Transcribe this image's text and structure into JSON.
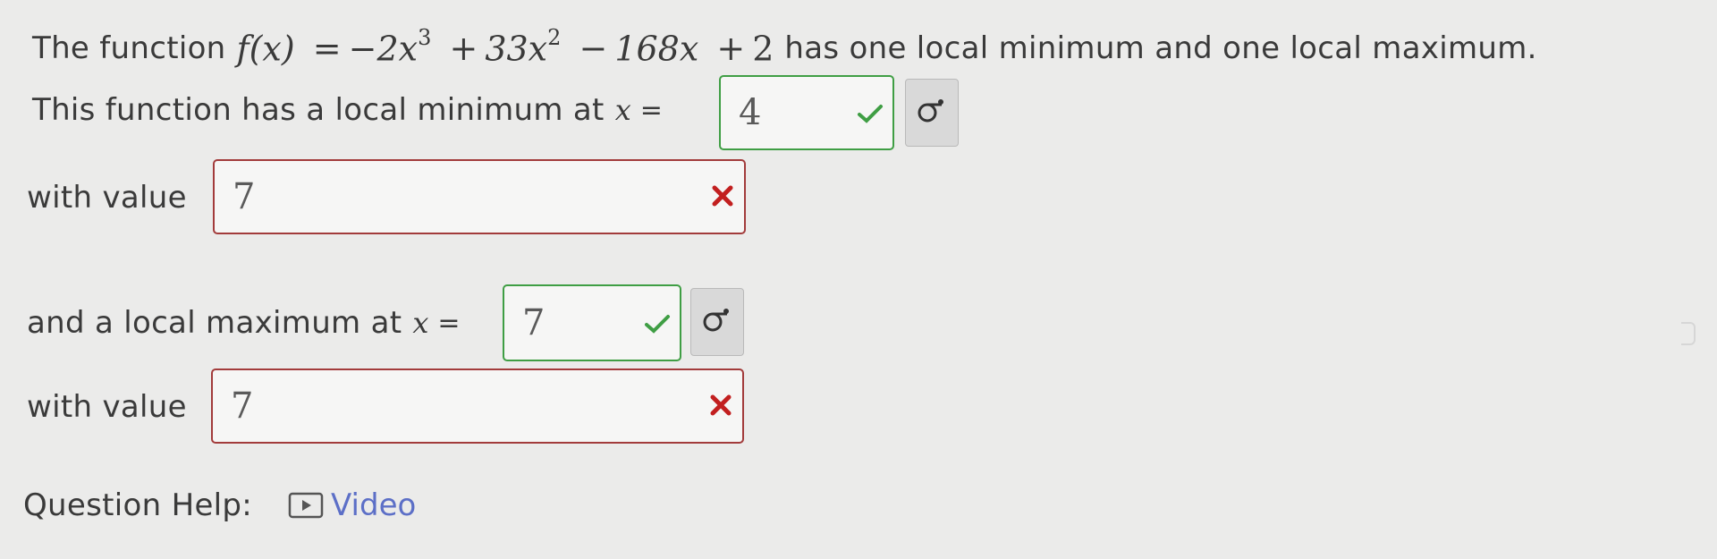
{
  "question": {
    "intro_prefix": "The function",
    "function_lhs": "f(x)",
    "function_eq": "=",
    "term1_coef": "−2x",
    "term1_exp": "3",
    "plus1": "+",
    "term2_coef": "33x",
    "term2_exp": "2",
    "minus": "−",
    "term3": "168x",
    "plus2": "+",
    "const": "2",
    "intro_suffix": "has one local minimum and one local maximum."
  },
  "local_min": {
    "label": "This function has a local minimum at",
    "var": "x",
    "eq": "=",
    "x_value": "4",
    "x_status": "correct",
    "value_label": "with value",
    "value": "7",
    "value_status": "incorrect"
  },
  "local_max": {
    "label": "and a local maximum at",
    "var": "x",
    "eq": "=",
    "x_value": "7",
    "x_status": "correct",
    "value_label": "with value",
    "value": "7",
    "value_status": "incorrect"
  },
  "help": {
    "label": "Question Help:",
    "video_label": "Video",
    "video_icon": "play-icon"
  },
  "icons": {
    "correct": "checkmark-icon",
    "incorrect": "x-mark-icon",
    "preview": "equation-preview-icon"
  },
  "colors": {
    "background": "#ebebea",
    "correct": "#3f9e44",
    "incorrect": "#a23b3b",
    "incorrect_mark": "#c21f1f",
    "link": "#5c6fc7"
  }
}
